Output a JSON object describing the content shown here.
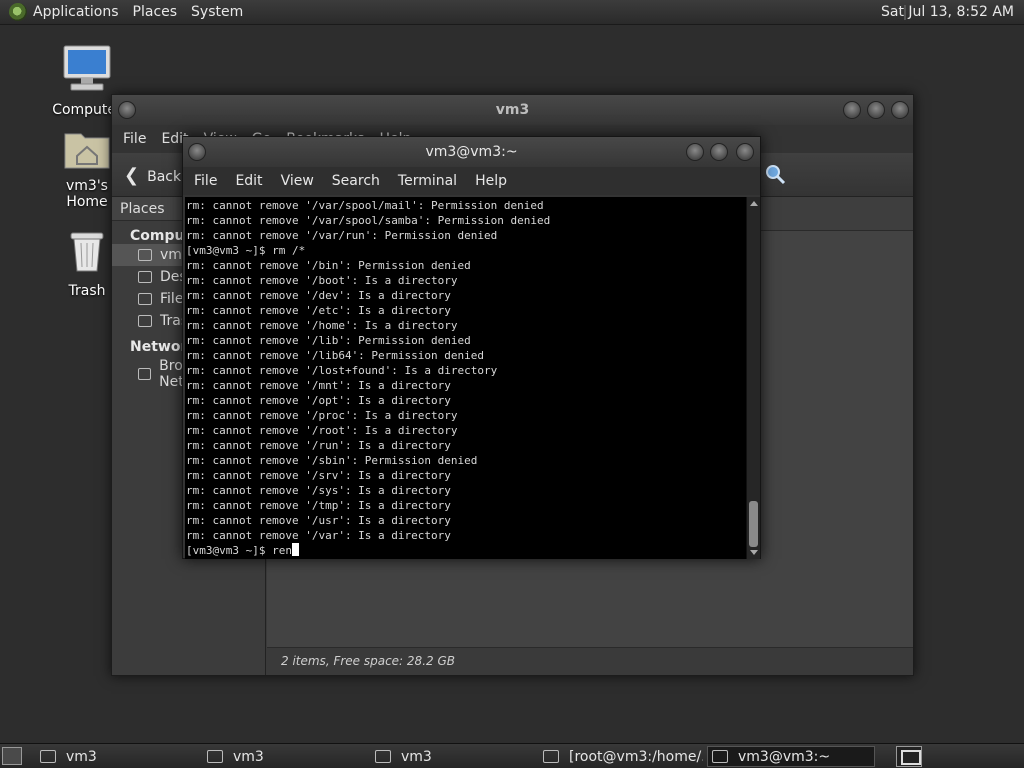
{
  "top_panel": {
    "menus": [
      "Applications",
      "Places",
      "System"
    ],
    "clock": "Sat Jul 13,  8:52 AM"
  },
  "desktop_icons": [
    {
      "label": "Computer",
      "icon": "computer-icon"
    },
    {
      "label": "vm3's Home",
      "icon": "home-folder-icon"
    },
    {
      "label": "Trash",
      "icon": "trash-icon"
    }
  ],
  "file_manager": {
    "title": "vm3",
    "menus": [
      "File",
      "Edit",
      "View",
      "Go",
      "Bookmarks",
      "Help"
    ],
    "back_label": "Back",
    "sidebar": {
      "header": "Places",
      "computer_section": "Computer",
      "computer_items": [
        "vm3",
        "Desktop",
        "File System",
        "Trash"
      ],
      "network_section": "Network",
      "network_items": [
        "Browse Network"
      ]
    },
    "status": "2 items, Free space: 28.2 GB"
  },
  "terminal": {
    "title": "vm3@vm3:~",
    "menus": [
      "File",
      "Edit",
      "View",
      "Search",
      "Terminal",
      "Help"
    ],
    "lines": [
      "rm: cannot remove '/var/spool/mail': Permission denied",
      "rm: cannot remove '/var/spool/samba': Permission denied",
      "rm: cannot remove '/var/run': Permission denied",
      "[vm3@vm3 ~]$ rm /*",
      "rm: cannot remove '/bin': Permission denied",
      "rm: cannot remove '/boot': Is a directory",
      "rm: cannot remove '/dev': Is a directory",
      "rm: cannot remove '/etc': Is a directory",
      "rm: cannot remove '/home': Is a directory",
      "rm: cannot remove '/lib': Permission denied",
      "rm: cannot remove '/lib64': Permission denied",
      "rm: cannot remove '/lost+found': Is a directory",
      "rm: cannot remove '/mnt': Is a directory",
      "rm: cannot remove '/opt': Is a directory",
      "rm: cannot remove '/proc': Is a directory",
      "rm: cannot remove '/root': Is a directory",
      "rm: cannot remove '/run': Is a directory",
      "rm: cannot remove '/sbin': Permission denied",
      "rm: cannot remove '/srv': Is a directory",
      "rm: cannot remove '/sys': Is a directory",
      "rm: cannot remove '/tmp': Is a directory",
      "rm: cannot remove '/usr': Is a directory",
      "rm: cannot remove '/var': Is a directory"
    ],
    "prompt": "[vm3@vm3 ~]$ ",
    "current_input": "ren"
  },
  "taskbar": {
    "tasks": [
      {
        "label": "vm3",
        "icon": "folder-icon",
        "active": false
      },
      {
        "label": "vm3",
        "icon": "folder-icon",
        "active": false
      },
      {
        "label": "vm3",
        "icon": "folder-icon",
        "active": false
      },
      {
        "label": "[root@vm3:/home/...",
        "icon": "terminal-icon",
        "active": false
      },
      {
        "label": "vm3@vm3:~",
        "icon": "terminal-icon",
        "active": true
      }
    ]
  }
}
